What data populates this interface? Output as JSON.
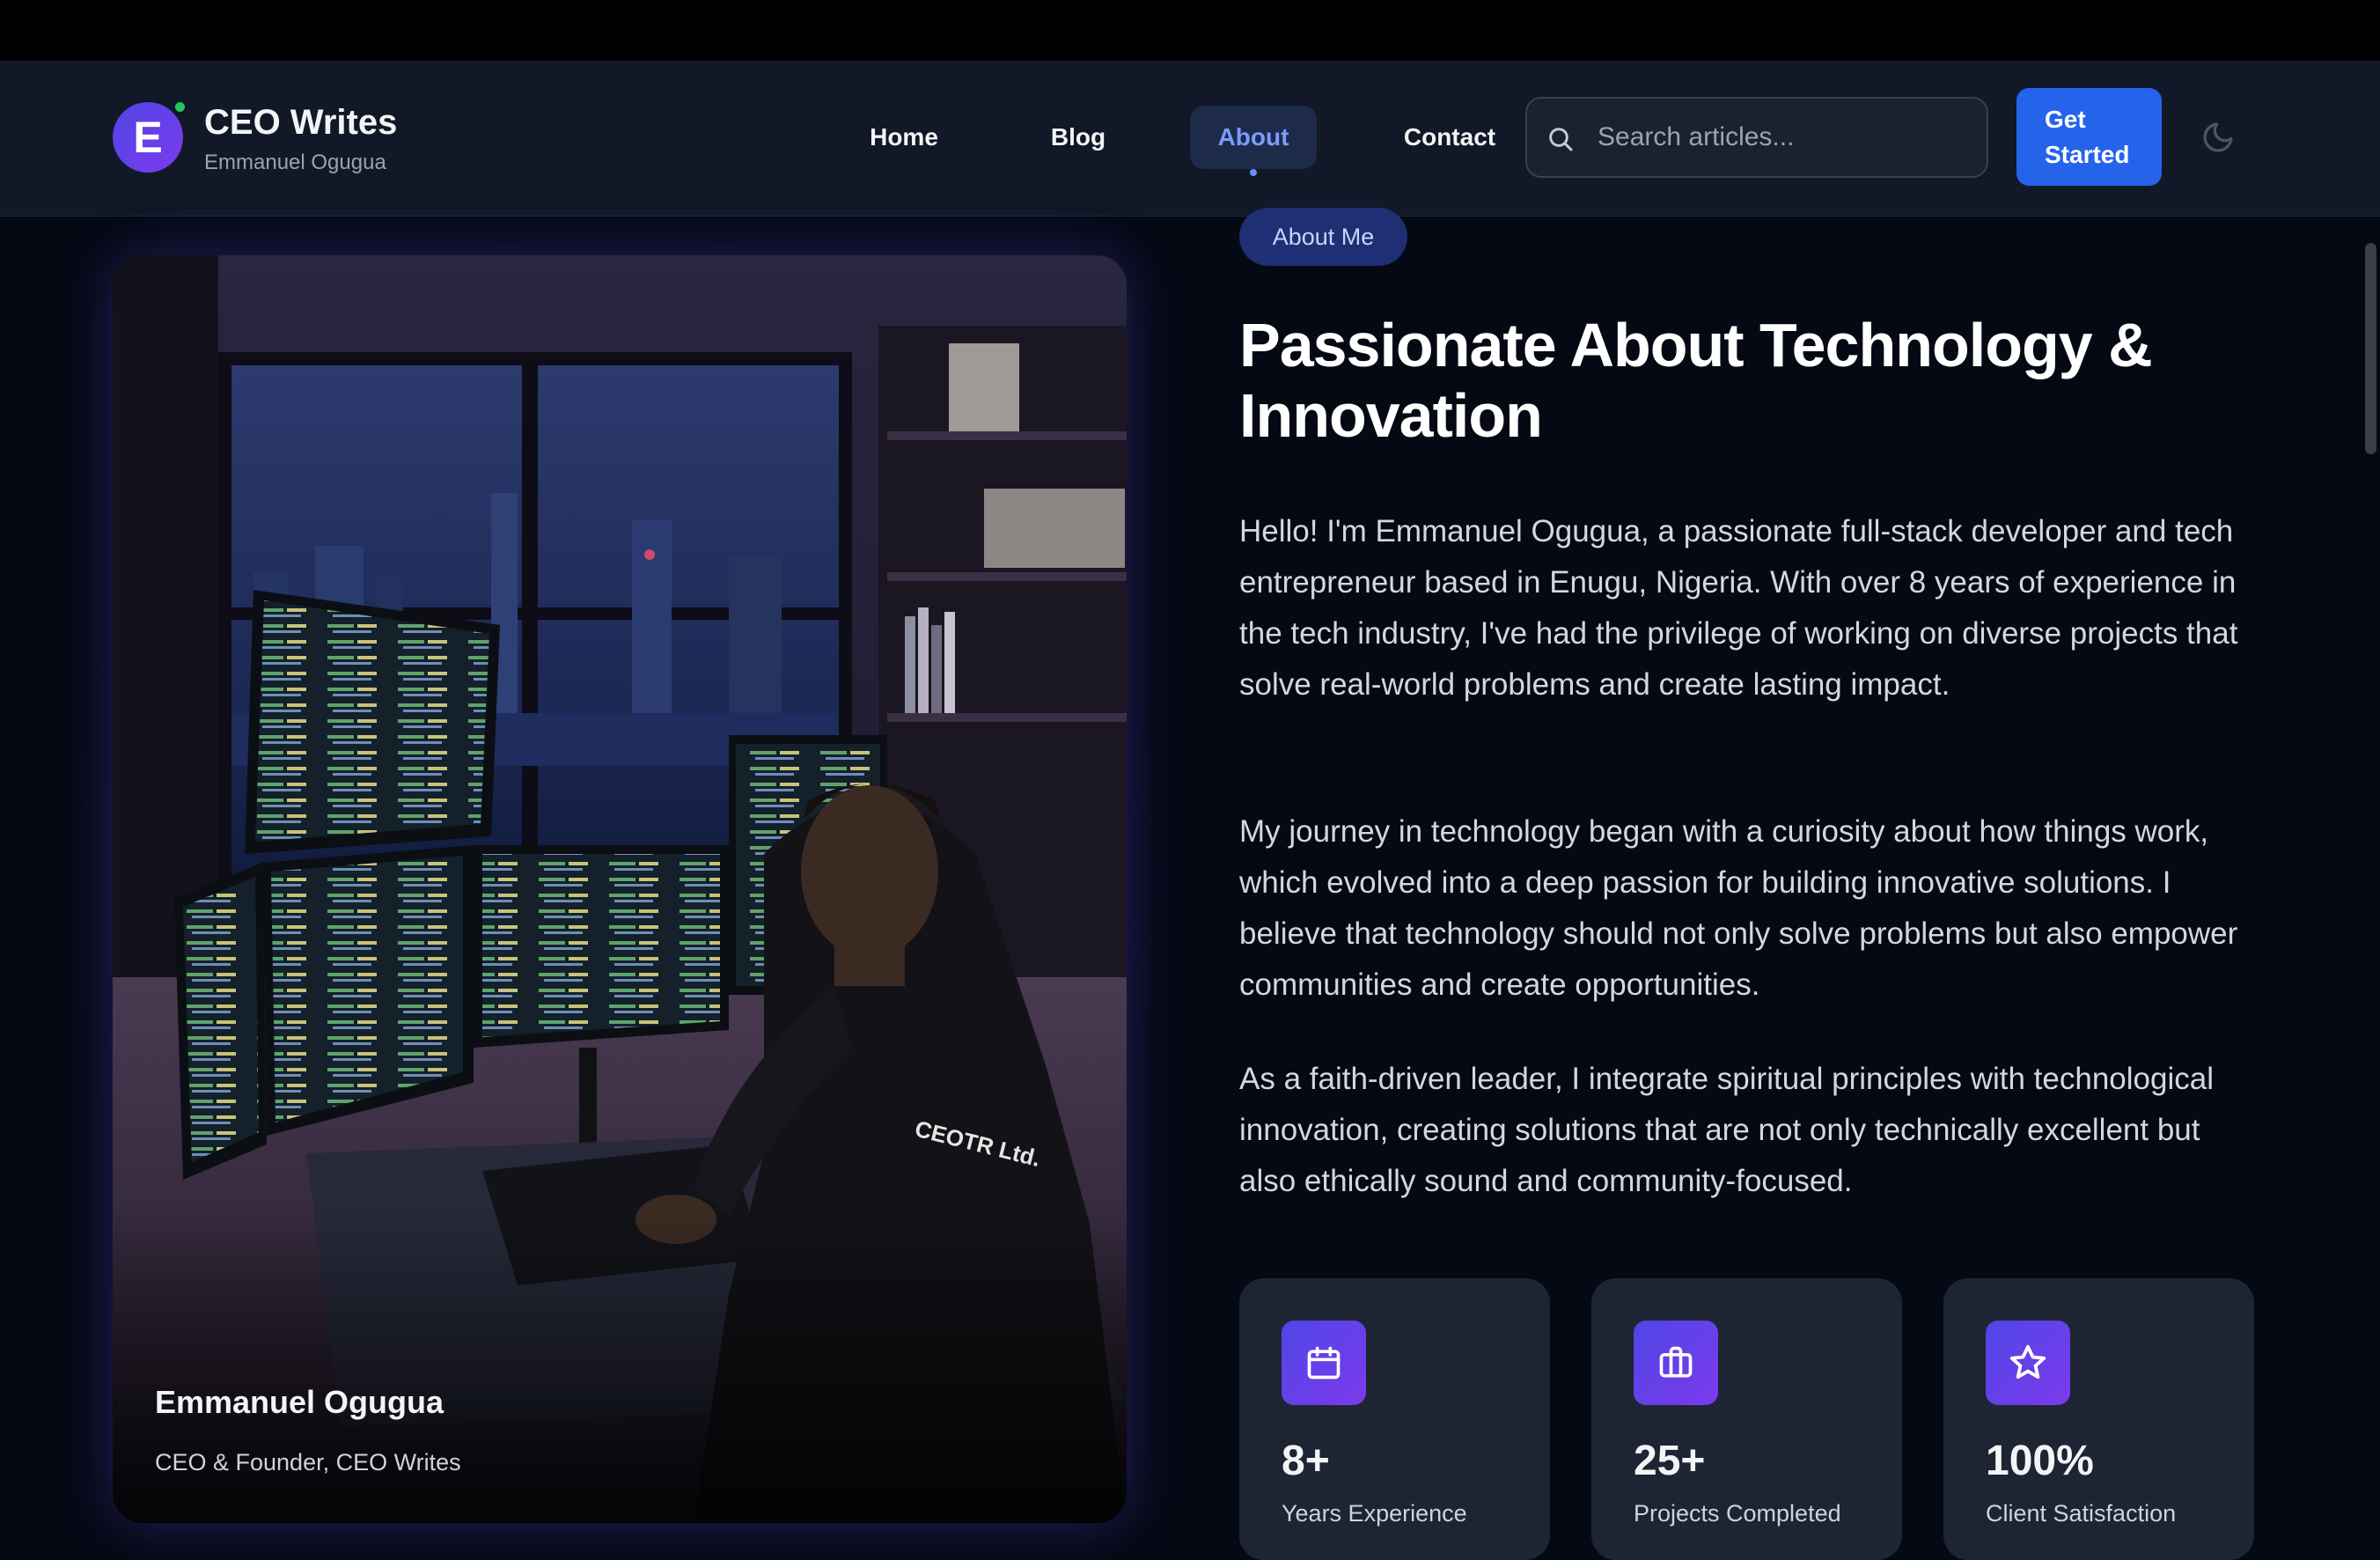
{
  "brand": {
    "logo_letter": "E",
    "title": "CEO Writes",
    "subtitle": "Emmanuel Ogugua"
  },
  "nav": {
    "home": "Home",
    "blog": "Blog",
    "about": "About",
    "contact": "Contact",
    "active": "About"
  },
  "search": {
    "placeholder": "Search articles..."
  },
  "cta": {
    "label": "Get Started"
  },
  "icons": {
    "theme_toggle": "moon-icon",
    "search": "search-icon"
  },
  "photo": {
    "name": "Emmanuel Ogugua",
    "role": "CEO & Founder, CEO Writes",
    "hoodie_text": "CEOTR Ltd."
  },
  "about": {
    "badge": "About Me",
    "heading": "Passionate About Technology & Innovation",
    "paragraphs": [
      "Hello! I'm Emmanuel Ogugua, a passionate full-stack developer and tech entrepreneur based in Enugu, Nigeria. With over 8 years of experience in the tech industry, I've had the privilege of working on diverse projects that solve real-world problems and create lasting impact.",
      "My journey in technology began with a curiosity about how things work, which evolved into a deep passion for building innovative solutions. I believe that technology should not only solve problems but also empower communities and create opportunities.",
      "As a faith-driven leader, I integrate spiritual principles with technological innovation, creating solutions that are not only technically excellent but also ethically sound and community-focused."
    ]
  },
  "stats": [
    {
      "icon": "calendar-icon",
      "value": "8+",
      "label": "Years Experience"
    },
    {
      "icon": "briefcase-icon",
      "value": "25+",
      "label": "Projects Completed"
    },
    {
      "icon": "star-icon",
      "value": "100%",
      "label": "Client Satisfaction"
    }
  ],
  "colors": {
    "accent": "#2563eb",
    "badge_bg": "#1e2f73",
    "page_bg": "#050914",
    "card_bg": "#1d2433"
  }
}
